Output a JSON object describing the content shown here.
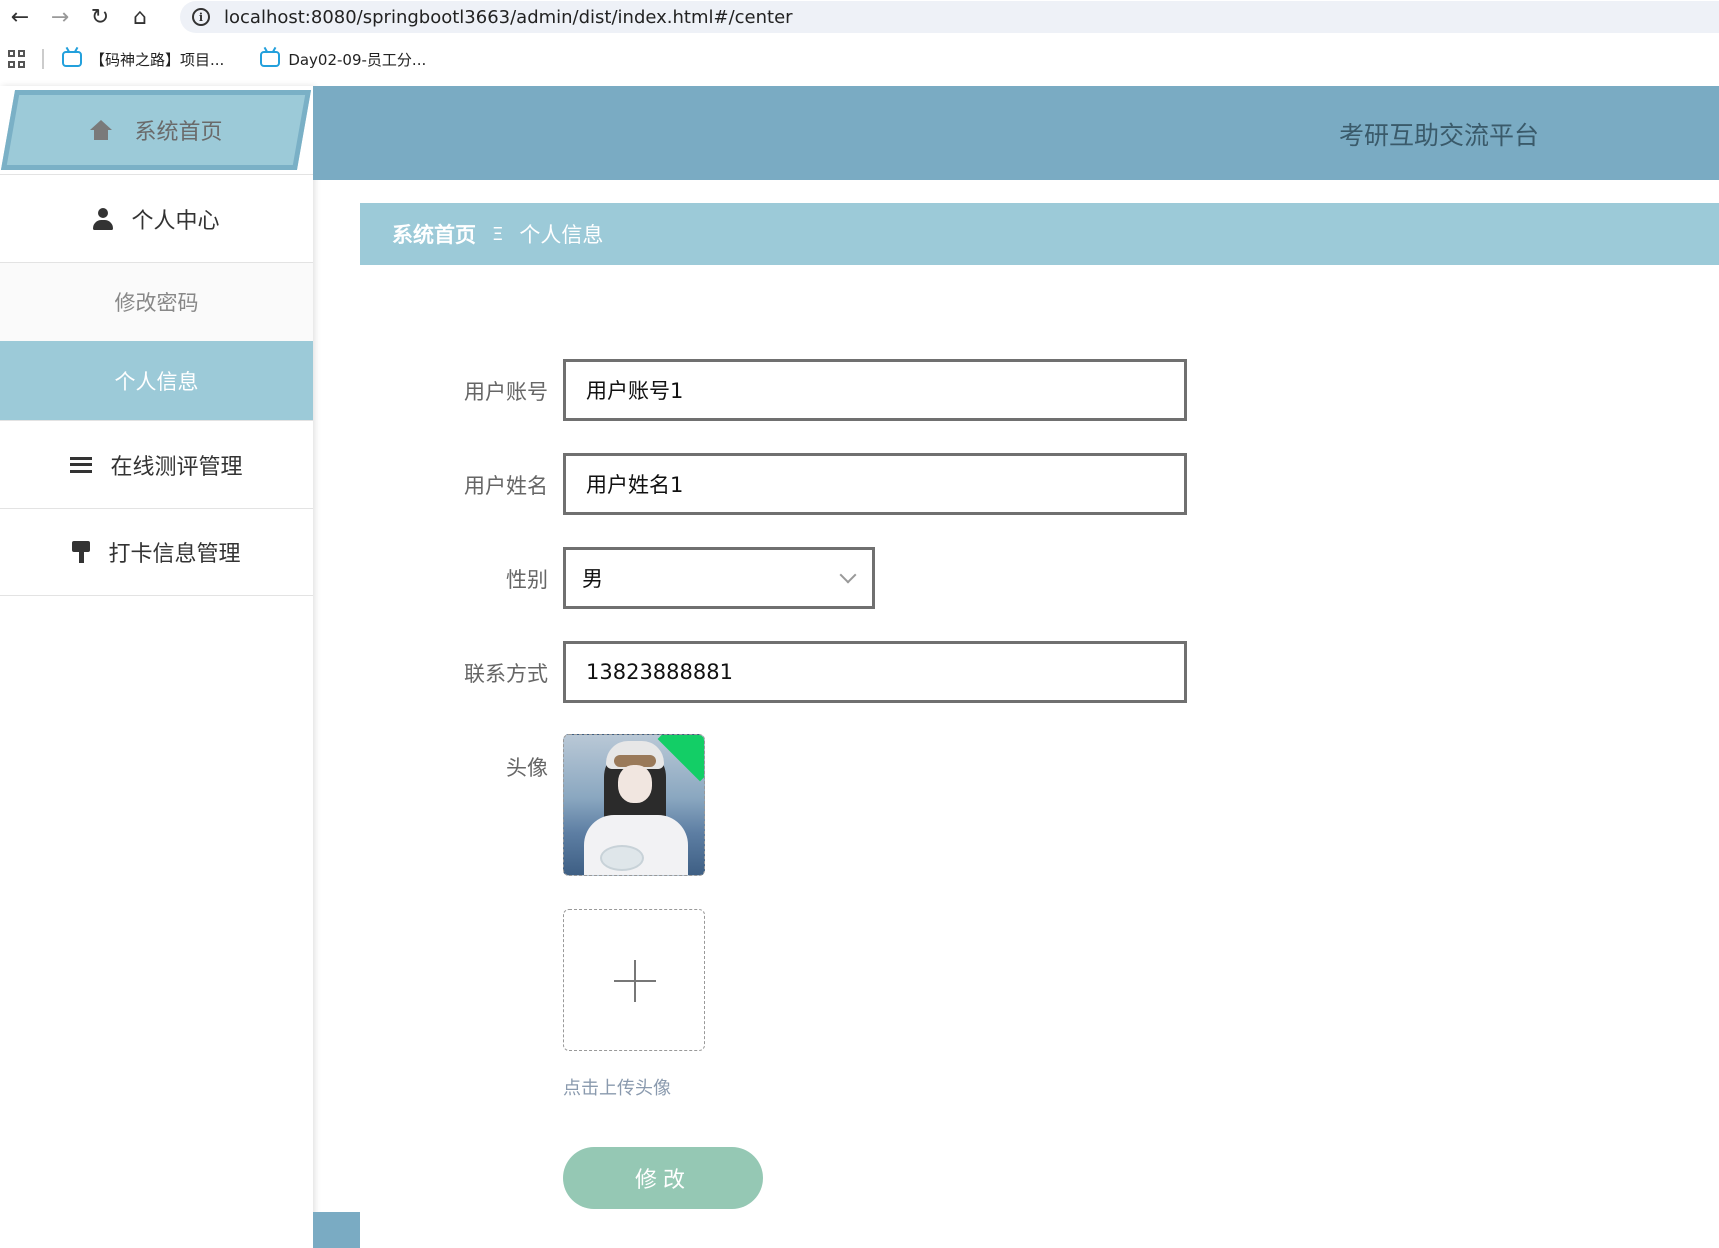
{
  "browser": {
    "url": "localhost:8080/springbootl3663/admin/dist/index.html#/center",
    "bookmarks": [
      {
        "label": "【码神之路】项目..."
      },
      {
        "label": "Day02-09-员工分..."
      }
    ]
  },
  "sidebar": {
    "home_label": "系统首页",
    "items": [
      {
        "label": "个人中心",
        "icon": "person-icon"
      },
      {
        "label": "修改密码"
      },
      {
        "label": "个人信息"
      },
      {
        "label": "在线测评管理",
        "icon": "list-icon"
      },
      {
        "label": "打卡信息管理",
        "icon": "brush-icon"
      }
    ]
  },
  "header": {
    "title": "考研互助交流平台"
  },
  "breadcrumb": {
    "home": "系统首页",
    "separator": "Ξ",
    "current": "个人信息"
  },
  "form": {
    "account_label": "用户账号",
    "account_value": "用户账号1",
    "name_label": "用户姓名",
    "name_value": "用户姓名1",
    "gender_label": "性别",
    "gender_value": "男",
    "phone_label": "联系方式",
    "phone_value": "13823888881",
    "avatar_label": "头像",
    "upload_tip": "点击上传头像",
    "submit_label": "修改"
  },
  "colors": {
    "header": "#7aabc3",
    "breadcrumb": "#9ccad8",
    "active_menu": "#9ccad8",
    "submit_button": "#95c8b4"
  }
}
